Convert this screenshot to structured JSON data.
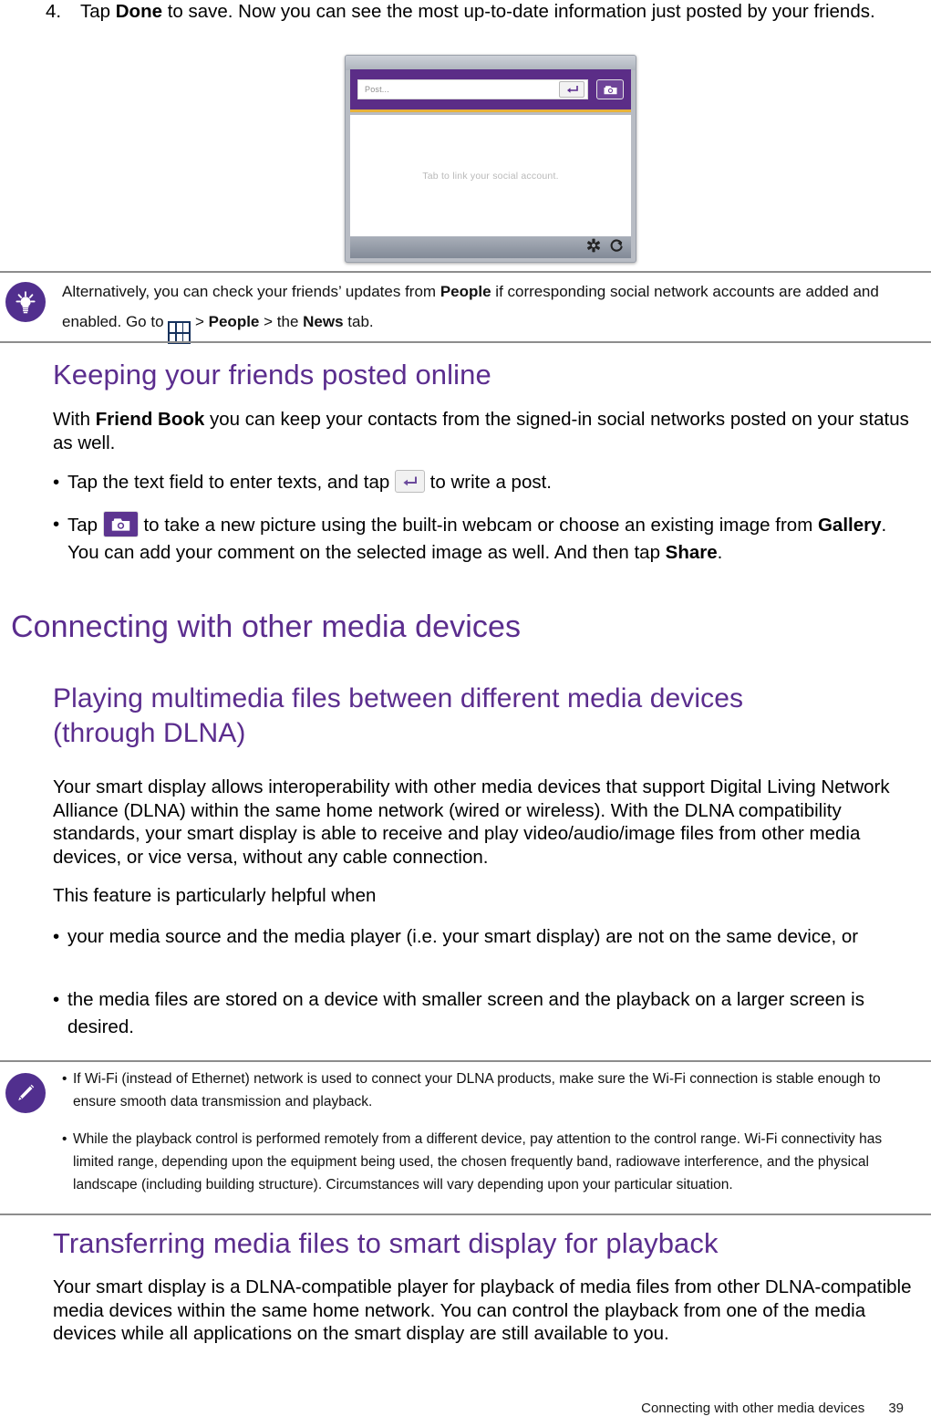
{
  "step": {
    "number": "4.",
    "text_before": "Tap ",
    "bold": "Done",
    "text_after": " to save. Now you can see the most up-to-date information just posted by your friends."
  },
  "figure": {
    "name": "friend-book-screenshot",
    "post_placeholder": "Post...",
    "canvas_hint": "Tab to link your social account.",
    "enter_icon": "enter-key-icon",
    "camera_icon": "camera-icon",
    "settings_icon": "gear-icon",
    "refresh_icon": "refresh-icon"
  },
  "tip": {
    "icon": "lightbulb-icon",
    "line1_a": "Alternatively, you can check your friends’ updates from ",
    "line1_b": "People",
    "line1_c": " if corresponding social network accounts are",
    "line2_a": "added and enabled. Go to ",
    "line2_grid_icon": "app-grid-icon",
    "line2_b": " > ",
    "line2_c": "People",
    "line2_d": " > the ",
    "line2_e": "News",
    "line2_f": " tab."
  },
  "section_keeping": {
    "heading": "Keeping your friends posted online",
    "intro_a": "With ",
    "intro_b": "Friend Book",
    "intro_c": " you can keep your contacts from the signed-in social networks posted on your status as well.",
    "bullets": [
      {
        "dot": "•",
        "a": "Tap the text field to enter texts, and tap ",
        "icon": "enter-key-icon",
        "b": " to write a post."
      },
      {
        "dot": "•",
        "a": "Tap ",
        "icon": "camera-icon",
        "b": " to take a new picture using the built-in webcam or choose an existing image from ",
        "bold": "Gallery",
        "c": ". You can add your comment on the selected image as well. And then tap ",
        "bold2": "Share",
        "d": "."
      }
    ]
  },
  "section_connecting": {
    "heading": "Connecting with other media devices",
    "sub_heading_line1": "Playing multimedia files between different media devices",
    "sub_heading_line2": "(through DLNA)",
    "para1": "Your smart display allows interoperability with other media devices that support Digital Living Network Alliance (DLNA) within the same home network (wired or wireless). With the DLNA compatibility standards, your smart display is able to receive and play video/audio/image files from other media devices, or vice versa, without any cable connection.",
    "para2": "This feature is particularly helpful when",
    "bullets": [
      {
        "dot": "•",
        "text": "your media source and the media player (i.e. your smart display) are not on the same device, or"
      },
      {
        "dot": "•",
        "text": "the media files are stored on a device with smaller screen and the playback on a larger screen is desired."
      }
    ]
  },
  "note": {
    "icon": "pencil-icon",
    "bullets": [
      {
        "dot": "•",
        "text": "If Wi-Fi (instead of Ethernet) network is used to connect your DLNA products, make sure the Wi-Fi connection is stable enough to ensure smooth data transmission and playback."
      },
      {
        "dot": "•",
        "text": "While the playback control is performed remotely from a different device, pay attention to the control range. Wi-Fi connectivity has limited range, depending upon the equipment being used, the chosen frequently band, radiowave interference, and the physical landscape (including building structure). Circumstances will vary depending upon your particular situation."
      }
    ]
  },
  "section_transferring": {
    "heading": "Transferring media files to smart display for playback",
    "para": "Your smart display is a DLNA-compatible player for playback of media files from other DLNA-compatible media devices within the same home network. You can control the playback from one of the media devices while all applications on the smart display are still available to you."
  },
  "footer": {
    "chapter": "Connecting with other media devices",
    "page": "39"
  },
  "colors": {
    "heading_purple": "#5b2d8e",
    "badge_purple": "#512f8e",
    "device_purple": "#5b2d87",
    "accent_gold": "#e8b33a",
    "grid_navy": "#15315c",
    "rule_gray": "#8d8d8d"
  }
}
